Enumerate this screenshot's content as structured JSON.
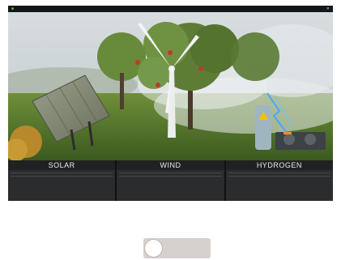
{
  "window": {
    "title": "",
    "left_label": "",
    "close_glyph": "✕"
  },
  "categories": [
    {
      "title": "SOLAR",
      "experiments": [
        "",
        "",
        ""
      ]
    },
    {
      "title": "WIND",
      "experiments": [
        "",
        "",
        ""
      ]
    },
    {
      "title": "HYDROGEN",
      "experiments": [
        "",
        "",
        ""
      ]
    }
  ],
  "toggle": {
    "state": "off"
  },
  "colors": {
    "accent": "#9fd36a",
    "column_bg": "#2a2c2e",
    "toggle_track": "#d6d0cf"
  },
  "icons": [
    "close-icon",
    "app-logo-icon"
  ]
}
